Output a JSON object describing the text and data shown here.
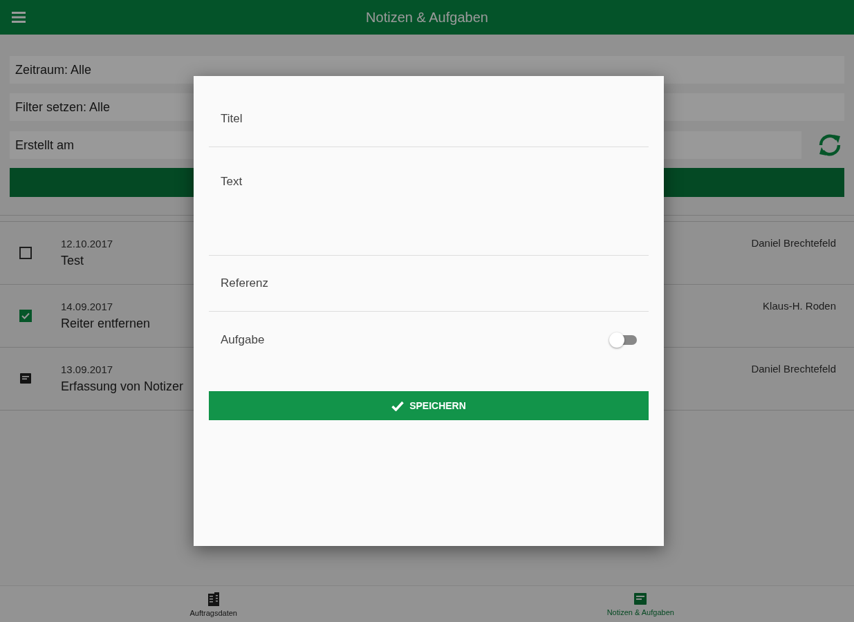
{
  "header": {
    "title": "Notizen & Aufgaben"
  },
  "filters": [
    {
      "text": "Zeitraum: Alle"
    },
    {
      "text": "Filter setzen: Alle"
    },
    {
      "text": "Erstellt am"
    }
  ],
  "items": [
    {
      "kind": "task",
      "checked": false,
      "date": "12.10.2017",
      "title": "Test",
      "author": "Daniel Brechtefeld"
    },
    {
      "kind": "task",
      "checked": true,
      "date": "14.09.2017",
      "title": "Reiter entfernen",
      "author": "Klaus-H. Roden"
    },
    {
      "kind": "note",
      "date": "13.09.2017",
      "title": "Erfassung von Notizer",
      "author": "Daniel Brechtefeld"
    }
  ],
  "dialog": {
    "fields": [
      {
        "kind": "line",
        "placeholder": "Titel"
      },
      {
        "kind": "area",
        "placeholder": "Text"
      },
      {
        "kind": "line",
        "placeholder": "Referenz"
      },
      {
        "kind": "toggle",
        "label": "Aufgabe",
        "on": false
      }
    ],
    "save_button": "SPEICHERN"
  },
  "tabs": [
    {
      "kind": "building",
      "label": "Auftragsdaten",
      "selected": false
    },
    {
      "kind": "note",
      "label": "Notizen & Aufgaben",
      "selected": true
    }
  ]
}
